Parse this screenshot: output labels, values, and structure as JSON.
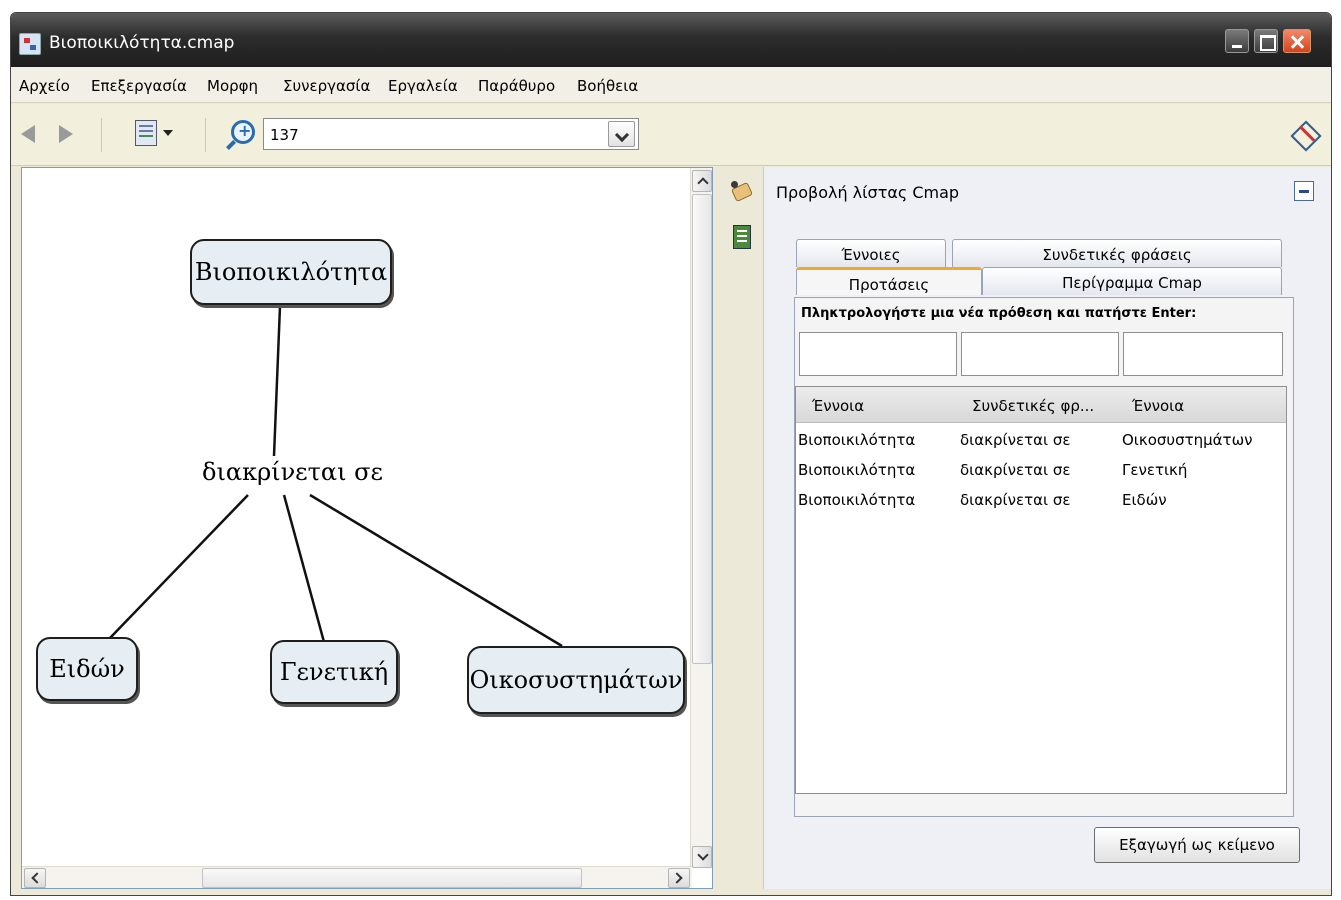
{
  "window": {
    "title": "Βιοποικιλότητα.cmap"
  },
  "menu": [
    "Αρχείο",
    "Επεξεργασία",
    "Μορφη",
    "Συνεργασία",
    "Εργαλεία",
    "Παράθυρο",
    "Βοήθεια"
  ],
  "toolbar": {
    "zoom_value": "137"
  },
  "concept_map": {
    "root": "Βιοποικιλότητα",
    "linking_phrase": "διακρίνεται σε",
    "children": [
      "Ειδών",
      "Γενετική",
      "Οικοσυστημάτων"
    ]
  },
  "right_panel": {
    "title": "Προβολή λίστας Cmap",
    "tabs_back": [
      "Έννοιες",
      "Συνδετικές φράσεις"
    ],
    "tabs_front": [
      "Προτάσεις",
      "Περίγραμμα Cmap"
    ],
    "active_tab": "Προτάσεις",
    "prompt": "Πληκτρολογήστε μια νέα πρόθεση και πατήστε Enter:",
    "table": {
      "headers": [
        "Έννοια",
        "Συνδετικές φρ...",
        "Έννοια"
      ],
      "rows": [
        [
          "Βιοποικιλότητα",
          "διακρίνεται σε",
          "Οικοσυστημάτων"
        ],
        [
          "Βιοποικιλότητα",
          "διακρίνεται σε",
          "Γενετική"
        ],
        [
          "Βιοποικιλότητα",
          "διακρίνεται σε",
          "Ειδών"
        ]
      ]
    },
    "export_label": "Εξαγωγή ως κείμενο"
  },
  "icons": {
    "app": "cmap-app-icon",
    "back": "back-arrow-icon",
    "forward": "forward-arrow-icon",
    "view": "view-mode-icon",
    "zoom": "zoom-in-icon",
    "tools": "tools-icon",
    "style": "style-palette-icon",
    "list": "list-view-icon"
  },
  "colors": {
    "concept_fill": "#e6eef4",
    "active_tab_accent": "#f0a830",
    "close_button": "#d9421c"
  }
}
